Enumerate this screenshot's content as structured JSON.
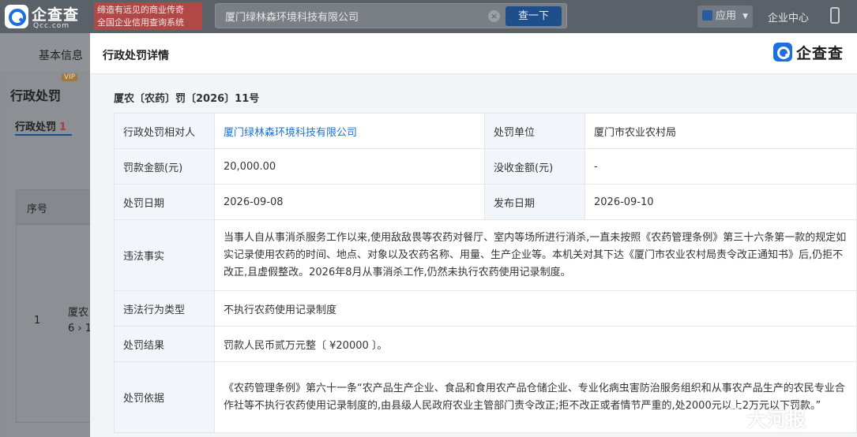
{
  "header": {
    "logo_text": "企查查",
    "logo_sub": "Qcc.com",
    "slogan_line1": "缔造有远见的商业传奇",
    "slogan_line2": "全国企业信用查询系统",
    "search_value": "厦门绿林森环境科技有限公司",
    "search_button": "查一下",
    "app_label": "应用",
    "enterprise_center": "企业中心"
  },
  "background": {
    "tab_basic": "基本信息",
    "section_title": "行政处罚",
    "vip": "VIP",
    "subtab_label": "行政处罚",
    "subtab_count": "1",
    "th_index": "序号",
    "row_index": "1",
    "row_cell_line1": "厦农",
    "row_cell_line2": "6 › 1"
  },
  "modal": {
    "title": "行政处罚详情",
    "logo_text": "企查查",
    "doc_number": "厦农〔农药〕罚〔2026〕11号",
    "rows": {
      "party_label": "行政处罚相对人",
      "party_value": "厦门绿林森环境科技有限公司",
      "unit_label": "处罚单位",
      "unit_value": "厦门市农业农村局",
      "fine_label": "罚款金额(元)",
      "fine_value": "20,000.00",
      "confiscate_label": "没收金额(元)",
      "confiscate_value": "-",
      "date_label": "处罚日期",
      "date_value": "2026-09-08",
      "publish_label": "发布日期",
      "publish_value": "2026-09-10",
      "facts_label": "违法事实",
      "facts_value": "当事人自从事消杀服务工作以来,使用敌敌畏等农药对餐厅、室内等场所进行消杀,一直未按照《农药管理条例》第三十六条第一款的规定如实记录使用农药的时间、地点、对象以及农药名称、用量、生产企业等。本机关对其下达《厦门市农业农村局责令改正通知书》后,仍拒不改正,且虚假整改。2026年8月从事消杀工作,仍然未执行农药使用记录制度。",
      "type_label": "违法行为类型",
      "type_value": "不执行农药使用记录制度",
      "result_label": "处罚结果",
      "result_value": "罚款人民币贰万元整〔 ¥20000 〕。",
      "basis_label": "处罚依据",
      "basis_value": "《农药管理条例》第六十一条“农产品生产企业、食品和食用农产品仓储企业、专业化病虫害防治服务组织和从事农产品生产的农民专业合作社等不执行农药使用记录制度的,由县级人民政府农业主管部门责令改正;拒不改正或者情节严重的,处2000元以上2万元以下罚款。”"
    }
  },
  "watermark": "大河报"
}
